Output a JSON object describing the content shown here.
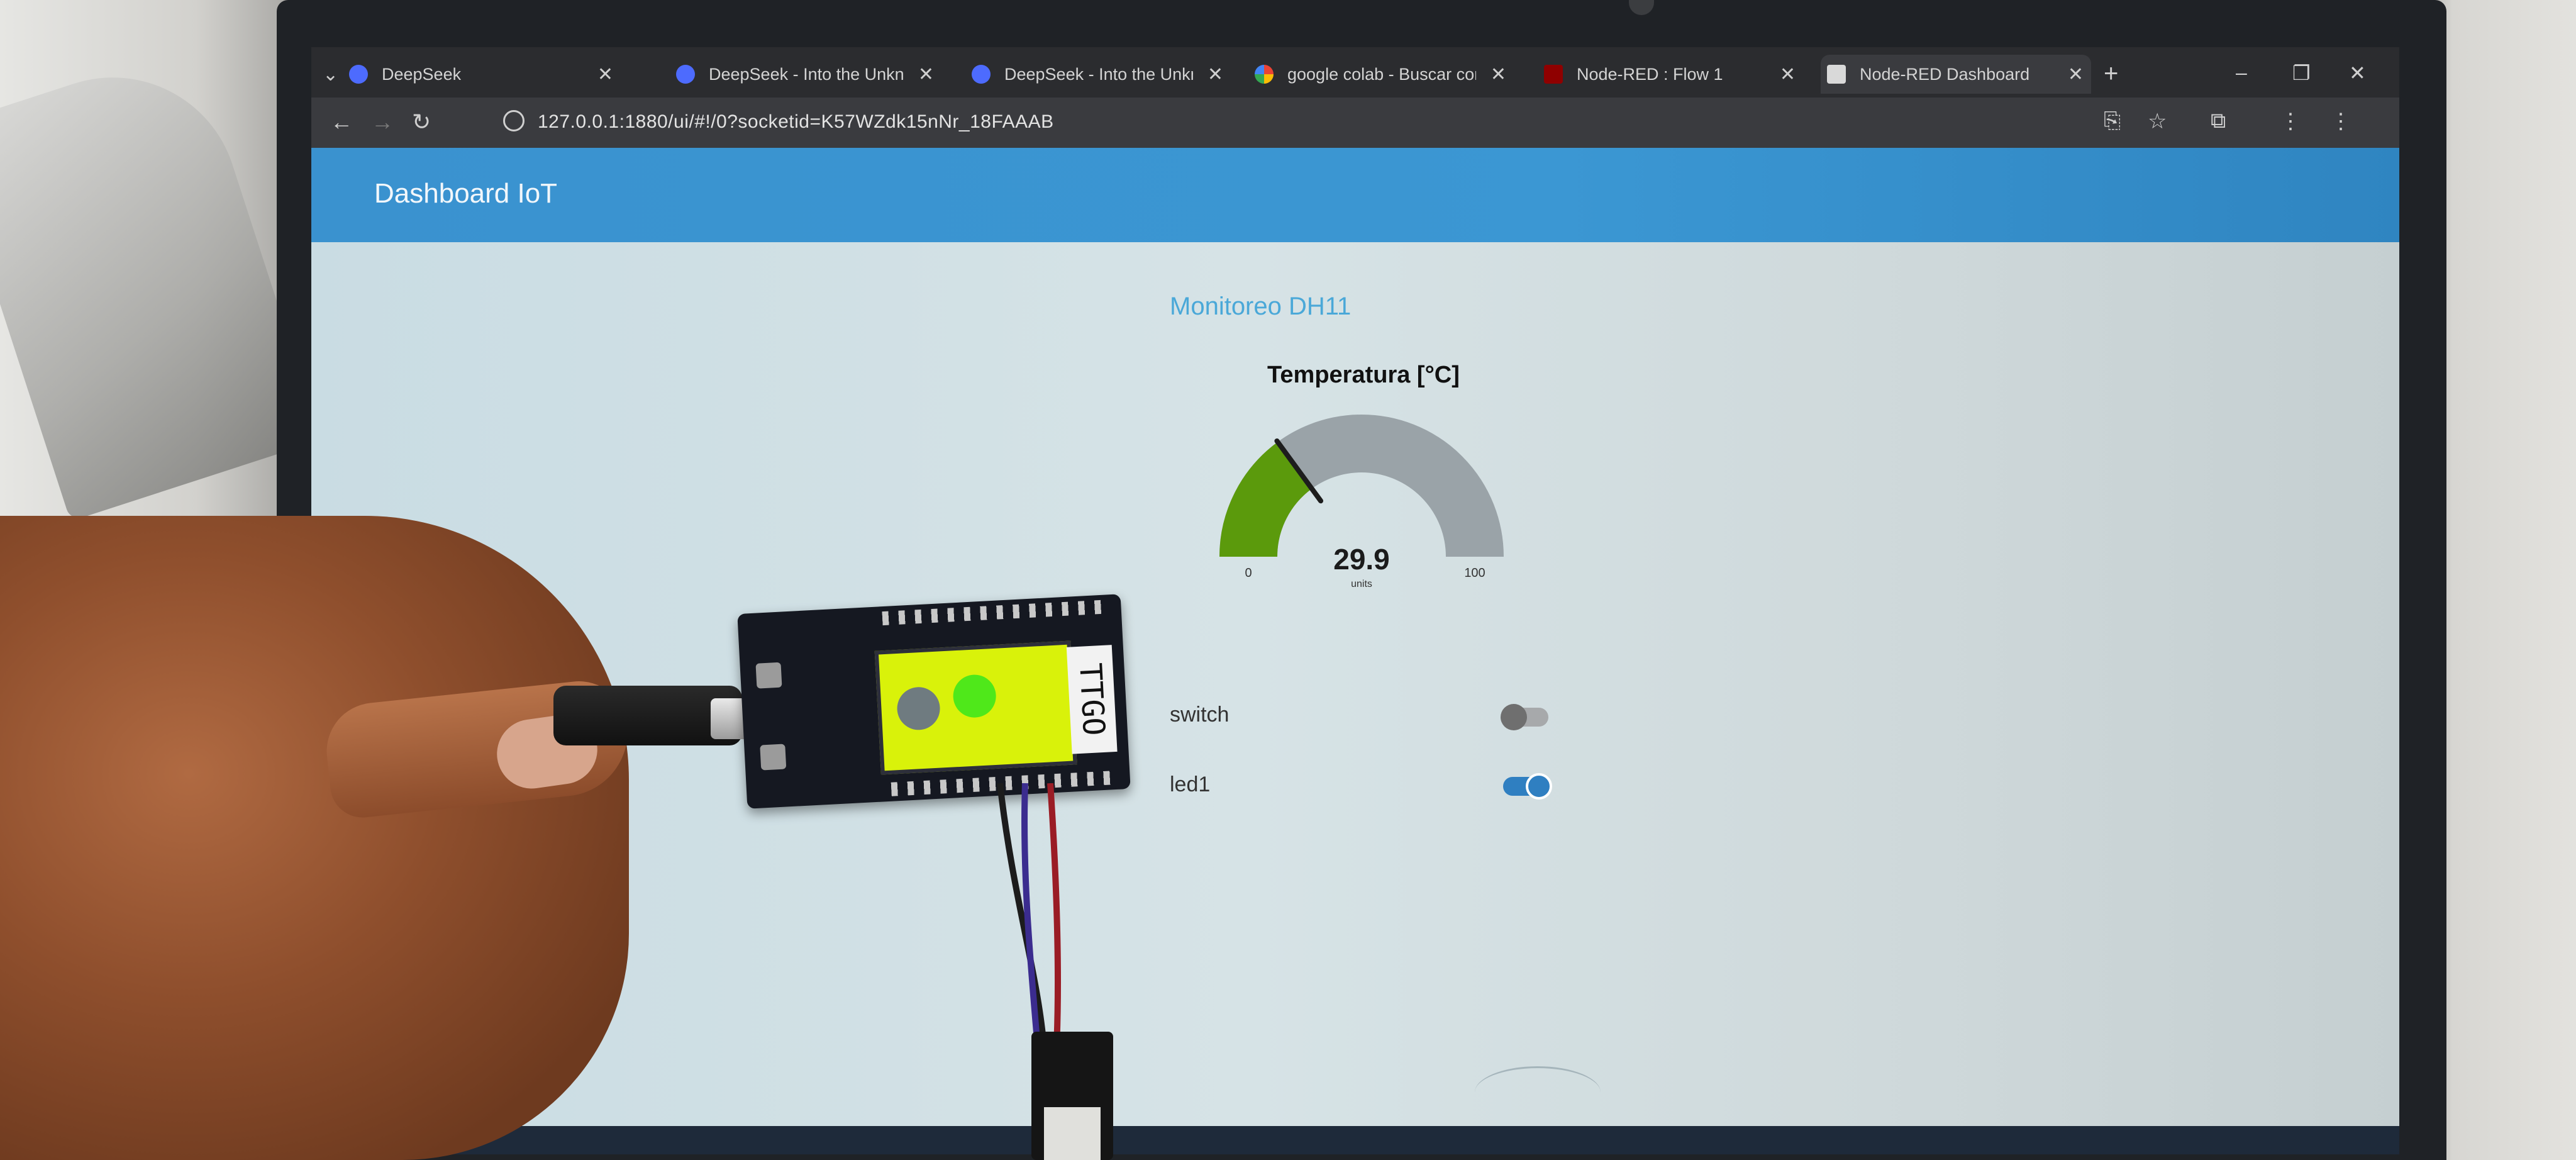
{
  "browser": {
    "tabs": [
      {
        "label": "DeepSeek",
        "icon": "deepseek-icon",
        "active": false
      },
      {
        "label": "DeepSeek - Into the Unkn",
        "icon": "deepseek-icon",
        "active": false
      },
      {
        "label": "DeepSeek - Into the Unkn",
        "icon": "deepseek-icon",
        "active": false
      },
      {
        "label": "google colab - Buscar con",
        "icon": "google-icon",
        "active": false
      },
      {
        "label": "Node-RED : Flow 1",
        "icon": "node-red-icon",
        "active": false
      },
      {
        "label": "Node-RED Dashboard",
        "icon": "node-red-dashboard-icon",
        "active": true
      }
    ],
    "url": "127.0.0.1:1880/ui/#!/0?socketid=K57WZdk15nNr_18FAAAB"
  },
  "dashboard": {
    "title": "Dashboard IoT",
    "group_title": "Monitoreo DH11",
    "gauge": {
      "title": "Temperatura [°C]",
      "value": 29.9,
      "value_label": "29.9",
      "units": "units",
      "min": 0,
      "max": 100,
      "min_label": "0",
      "max_label": "100",
      "fill_color": "#5b9a0c",
      "track_color": "#9aa3a8"
    },
    "switches": [
      {
        "label": "switch",
        "on": false
      },
      {
        "label": "led1",
        "on": true
      }
    ],
    "colors": {
      "header": "#3b97d3",
      "accent": "#4aa8d8",
      "toggle_on": "#2f7fc1",
      "toggle_off": "#6f6f6f"
    }
  },
  "device": {
    "board_label": "TTGO",
    "display_background": "#d9f20a",
    "led_off_color": "#6f7b80",
    "led_on_color": "#4fe81a"
  }
}
